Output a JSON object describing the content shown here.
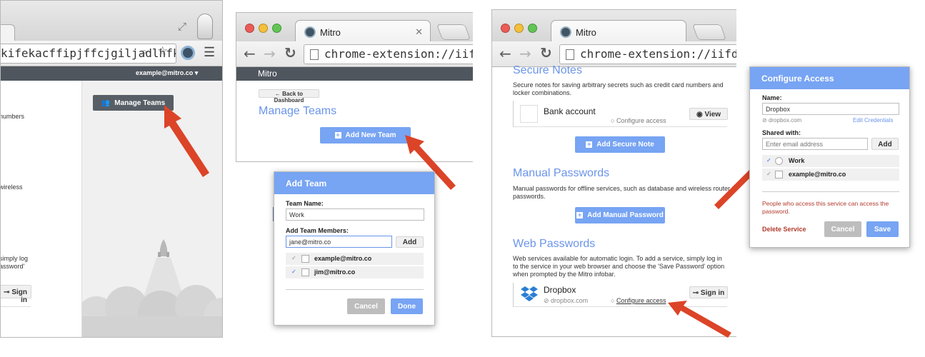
{
  "panel1": {
    "url": "kifekacffipjffcjgiljadlhfkc/ht…",
    "user": "example@mitro.co ▾",
    "manage_teams": "Manage Teams",
    "frag1": "numbers",
    "frag2": "wireless",
    "frag3": "simply log",
    "frag4": "assword'",
    "sign_in": "Sign in"
  },
  "panel2": {
    "tab": "Mitro",
    "url": "chrome-extension://iifdnkifekacf",
    "logo": "Mitro",
    "back": "Back to\nDashboard",
    "title": "Manage Teams",
    "add_team": "Add New Team"
  },
  "add_team": {
    "title": "Add Team",
    "name_label": "Team Name:",
    "name_value": "Work",
    "members_label": "Add Team Members:",
    "member_input": "jane@mitro.co",
    "add": "Add",
    "members": [
      "example@mitro.co",
      "jim@mitro.co"
    ],
    "cancel": "Cancel",
    "done": "Done"
  },
  "panel3": {
    "tab": "Mitro",
    "url": "chrome-extension://iifdnkifekacffi",
    "secure_title": "Secure Notes",
    "secure_desc": "Secure notes for saving arbitrary secrets such as credit card numbers and locker combinations.",
    "bank": "Bank account",
    "configure": "Configure access",
    "view": "View",
    "add_note": "Add Secure Note",
    "manual_title": "Manual Passwords",
    "manual_desc": "Manual passwords for offline services, such as database and wireless router passwords.",
    "add_manual": "Add Manual Password",
    "web_title": "Web Passwords",
    "web_desc": "Web services available for automatic login. To add a service, simply log in to the service in your web browser and choose the 'Save Password' option when prompted by the Mitro infobar.",
    "dropbox": "Dropbox",
    "dropbox_domain": "dropbox.com",
    "configure2": "Configure access",
    "sign_in": "Sign in"
  },
  "configure": {
    "title": "Configure Access",
    "name_label": "Name:",
    "name_value": "Dropbox",
    "domain": "dropbox.com",
    "edit": "Edit Credentials",
    "shared_label": "Shared with:",
    "email_placeholder": "Enter email address",
    "add": "Add",
    "shared": [
      "Work",
      "example@mitro.co"
    ],
    "warning": "People who access this service can access the password.",
    "delete": "Delete Service",
    "cancel": "Cancel",
    "save": "Save"
  },
  "colors": {
    "accent": "#77a4f3",
    "header_dark": "#4f565e",
    "arrow": "#dc4428"
  }
}
